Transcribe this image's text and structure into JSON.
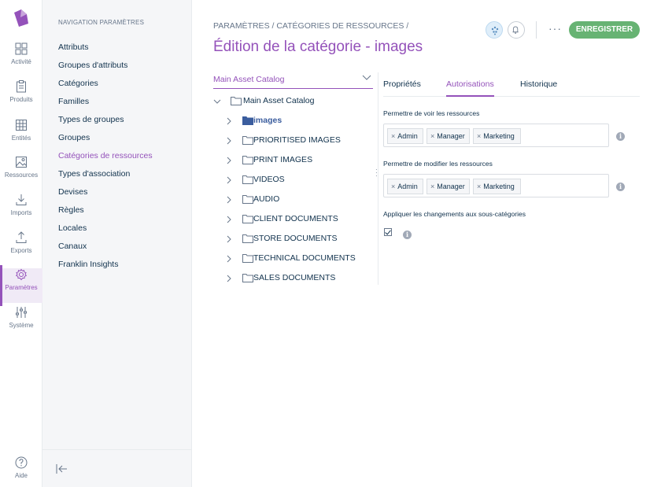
{
  "main_nav": {
    "items": [
      {
        "label": "Activité",
        "icon": "dashboard-icon"
      },
      {
        "label": "Produits",
        "icon": "clipboard-icon"
      },
      {
        "label": "Entités",
        "icon": "grid-icon"
      },
      {
        "label": "Ressources",
        "icon": "image-icon"
      },
      {
        "label": "Imports",
        "icon": "import-icon"
      },
      {
        "label": "Exports",
        "icon": "export-icon"
      },
      {
        "label": "Paramètres",
        "icon": "gear-icon"
      },
      {
        "label": "Système",
        "icon": "sliders-icon"
      }
    ],
    "help_label": "Aide",
    "accent_color": "#9452ba"
  },
  "settings_nav": {
    "title": "NAVIGATION PARAMÈTRES",
    "items": [
      {
        "label": "Attributs"
      },
      {
        "label": "Groupes d'attributs"
      },
      {
        "label": "Catégories"
      },
      {
        "label": "Familles"
      },
      {
        "label": "Types de groupes"
      },
      {
        "label": "Groupes"
      },
      {
        "label": "Catégories de ressources"
      },
      {
        "label": "Types d'association"
      },
      {
        "label": "Devises"
      },
      {
        "label": "Règles"
      },
      {
        "label": "Locales"
      },
      {
        "label": "Canaux"
      },
      {
        "label": "Franklin Insights"
      }
    ],
    "active_item": "Catégories de ressources"
  },
  "header": {
    "breadcrumb": "PARAMÈTRES / CATÉGORIES DE RESSOURCES /",
    "title": "Édition de la catégorie - images",
    "more_label": "···",
    "save_label": "ENREGISTRER",
    "save_color": "#67b373"
  },
  "tree": {
    "selector_value": "Main Asset Catalog",
    "root": "Main Asset Catalog",
    "children": [
      {
        "label": "images",
        "selected": true
      },
      {
        "label": "PRIORITISED IMAGES"
      },
      {
        "label": "PRINT IMAGES"
      },
      {
        "label": "VIDEOS"
      },
      {
        "label": "AUDIO"
      },
      {
        "label": "CLIENT DOCUMENTS"
      },
      {
        "label": "STORE DOCUMENTS"
      },
      {
        "label": "TECHNICAL DOCUMENTS"
      },
      {
        "label": "SALES DOCUMENTS"
      }
    ]
  },
  "tabs": [
    {
      "label": "Propriétés"
    },
    {
      "label": "Autorisations",
      "active": true
    },
    {
      "label": "Historique"
    }
  ],
  "permissions": {
    "view": {
      "label": "Permettre de voir les ressources",
      "tags": [
        "Admin",
        "Manager",
        "Marketing"
      ]
    },
    "edit": {
      "label": "Permettre de modifier les ressources",
      "tags": [
        "Admin",
        "Manager",
        "Marketing"
      ]
    },
    "apply_children": {
      "label": "Appliquer les changements aux sous-catégories",
      "checked": true
    }
  }
}
